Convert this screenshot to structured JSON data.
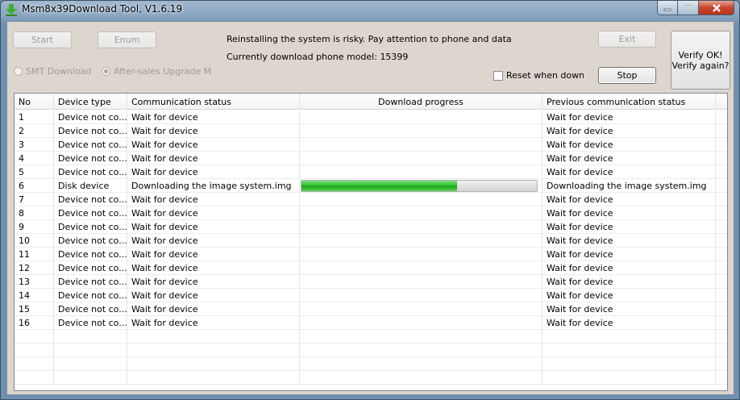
{
  "window": {
    "title": "Msm8x39Download Tool, V1.6.19"
  },
  "toolbar": {
    "start_label": "Start",
    "enum_label": "Enum",
    "exit_label": "Exit",
    "stop_label": "Stop",
    "verify_line1": "Verify OK!",
    "verify_line2": "Verify again?"
  },
  "info": {
    "warning": "Reinstalling the system is risky. Pay attention to phone and data",
    "model_text": "Currently download phone model: 15399"
  },
  "modes": {
    "smt_label": "SMT Download Mo",
    "aftersales_label": "After-sales Upgrade Moc",
    "selected": "aftersales"
  },
  "options": {
    "reset_label": "Reset when downlc",
    "reset_checked": false
  },
  "table": {
    "headers": {
      "no": "No",
      "device": "Device type",
      "comm": "Communication status",
      "progress": "Download progress",
      "prev": "Previous communication status"
    },
    "rows": [
      {
        "no": "1",
        "device": "Device not co...",
        "comm": "Wait for device",
        "progress": null,
        "prev": "Wait for device"
      },
      {
        "no": "2",
        "device": "Device not co...",
        "comm": "Wait for device",
        "progress": null,
        "prev": "Wait for device"
      },
      {
        "no": "3",
        "device": "Device not co...",
        "comm": "Wait for device",
        "progress": null,
        "prev": "Wait for device"
      },
      {
        "no": "4",
        "device": "Device not co...",
        "comm": "Wait for device",
        "progress": null,
        "prev": "Wait for device"
      },
      {
        "no": "5",
        "device": "Device not co...",
        "comm": "Wait for device",
        "progress": null,
        "prev": "Wait for device"
      },
      {
        "no": "6",
        "device": "Disk device",
        "comm": "Downloading the image system.img",
        "progress": 0.66,
        "prev": "Downloading the image system.img"
      },
      {
        "no": "7",
        "device": "Device not co...",
        "comm": "Wait for device",
        "progress": null,
        "prev": "Wait for device"
      },
      {
        "no": "8",
        "device": "Device not co...",
        "comm": "Wait for device",
        "progress": null,
        "prev": "Wait for device"
      },
      {
        "no": "9",
        "device": "Device not co...",
        "comm": "Wait for device",
        "progress": null,
        "prev": "Wait for device"
      },
      {
        "no": "10",
        "device": "Device not co...",
        "comm": "Wait for device",
        "progress": null,
        "prev": "Wait for device"
      },
      {
        "no": "11",
        "device": "Device not co...",
        "comm": "Wait for device",
        "progress": null,
        "prev": "Wait for device"
      },
      {
        "no": "12",
        "device": "Device not co...",
        "comm": "Wait for device",
        "progress": null,
        "prev": "Wait for device"
      },
      {
        "no": "13",
        "device": "Device not co...",
        "comm": "Wait for device",
        "progress": null,
        "prev": "Wait for device"
      },
      {
        "no": "14",
        "device": "Device not co...",
        "comm": "Wait for device",
        "progress": null,
        "prev": "Wait for device"
      },
      {
        "no": "15",
        "device": "Device not co...",
        "comm": "Wait for device",
        "progress": null,
        "prev": "Wait for device"
      },
      {
        "no": "16",
        "device": "Device not co...",
        "comm": "Wait for device",
        "progress": null,
        "prev": "Wait for device"
      }
    ],
    "blank_rows": 4
  },
  "colors": {
    "progress_fill": "#1ca51c",
    "client_bg": "#ddd6cf"
  }
}
